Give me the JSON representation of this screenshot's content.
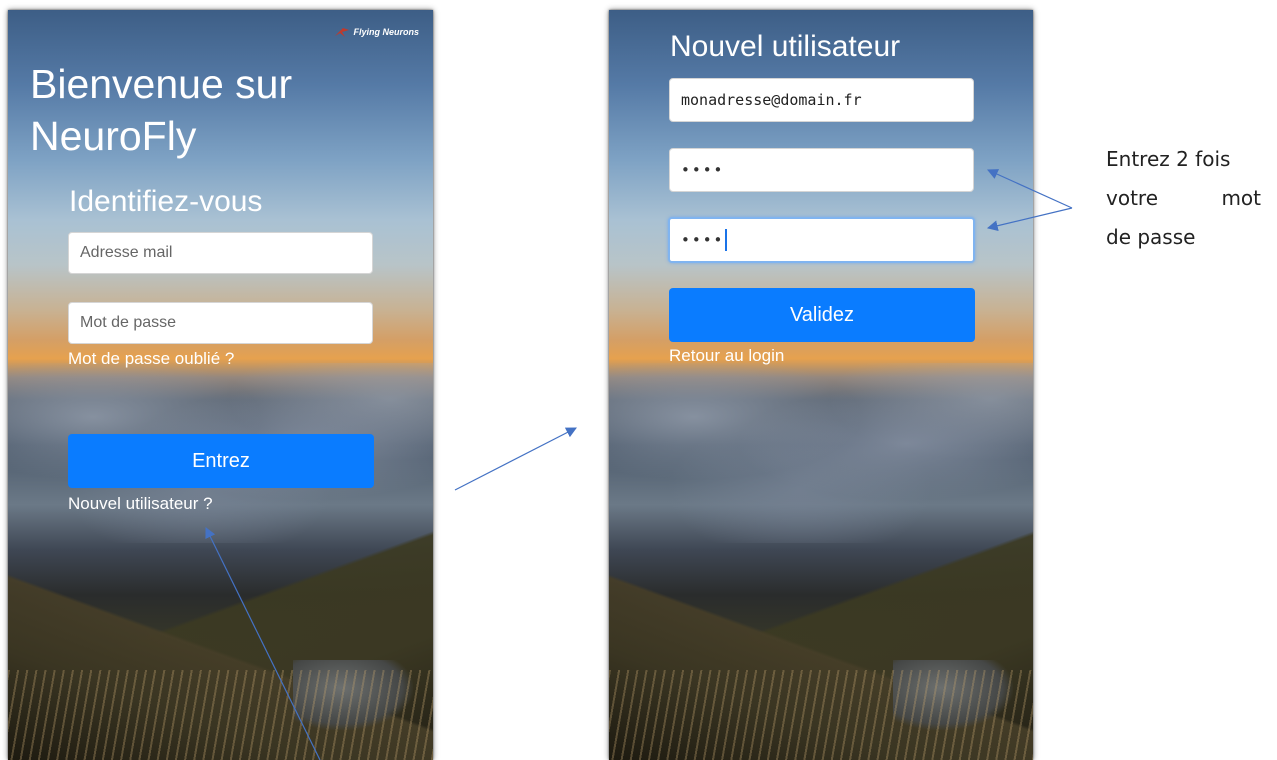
{
  "left_screen": {
    "logo_text": "Flying Neurons",
    "welcome_line1": "Bienvenue sur",
    "welcome_line2": "NeuroFly",
    "subtitle": "Identifiez-vous",
    "email_placeholder": "Adresse mail",
    "password_placeholder": "Mot de passe",
    "forgot_link": "Mot de passe oublié ?",
    "submit_label": "Entrez",
    "new_user_link": "Nouvel utilisateur ?"
  },
  "right_screen": {
    "title": "Nouvel utilisateur",
    "email_value": "monadresse@domain.fr",
    "password1_value": "••••",
    "password2_value": "••••",
    "submit_label": "Validez",
    "back_link": "Retour au login"
  },
  "annotation": {
    "line1": "Entrez 2 fois",
    "line2_word1": "votre",
    "line2_word2": "mot",
    "line3": "de passe"
  },
  "colors": {
    "button_blue": "#0a7cff",
    "arrow_blue": "#4472c4"
  }
}
